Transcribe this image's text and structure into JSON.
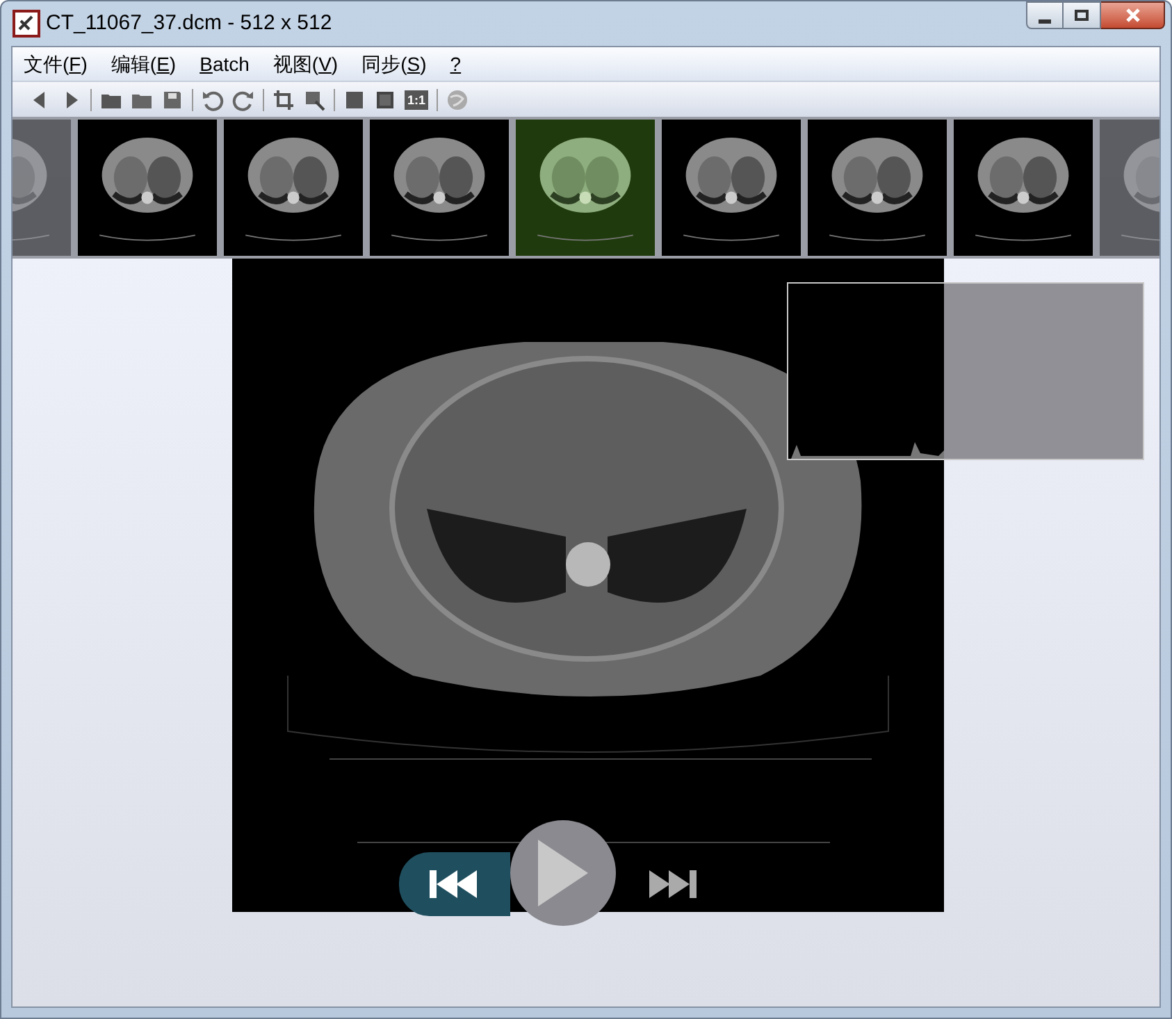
{
  "window": {
    "title": "CT_11067_37.dcm - 512 x 512"
  },
  "menu": [
    {
      "before": "文件(",
      "underlined": "F",
      "after": ")"
    },
    {
      "before": "编辑(",
      "underlined": "E",
      "after": ")"
    },
    {
      "underlined": "B",
      "after": "atch"
    },
    {
      "before": "视图(",
      "underlined": "V",
      "after": ")"
    },
    {
      "before": "同步(",
      "underlined": "S",
      "after": ")"
    },
    {
      "underlined": "?"
    }
  ],
  "toolbar": {
    "actual_size_label": "1:1"
  },
  "thumbnails": [
    {
      "selected": false,
      "kind": "edge"
    },
    {
      "selected": false,
      "kind": "scan"
    },
    {
      "selected": false,
      "kind": "scan"
    },
    {
      "selected": false,
      "kind": "scan"
    },
    {
      "selected": true,
      "kind": "scan"
    },
    {
      "selected": false,
      "kind": "scan"
    },
    {
      "selected": false,
      "kind": "scan"
    },
    {
      "selected": false,
      "kind": "scan"
    },
    {
      "selected": false,
      "kind": "edge"
    }
  ]
}
